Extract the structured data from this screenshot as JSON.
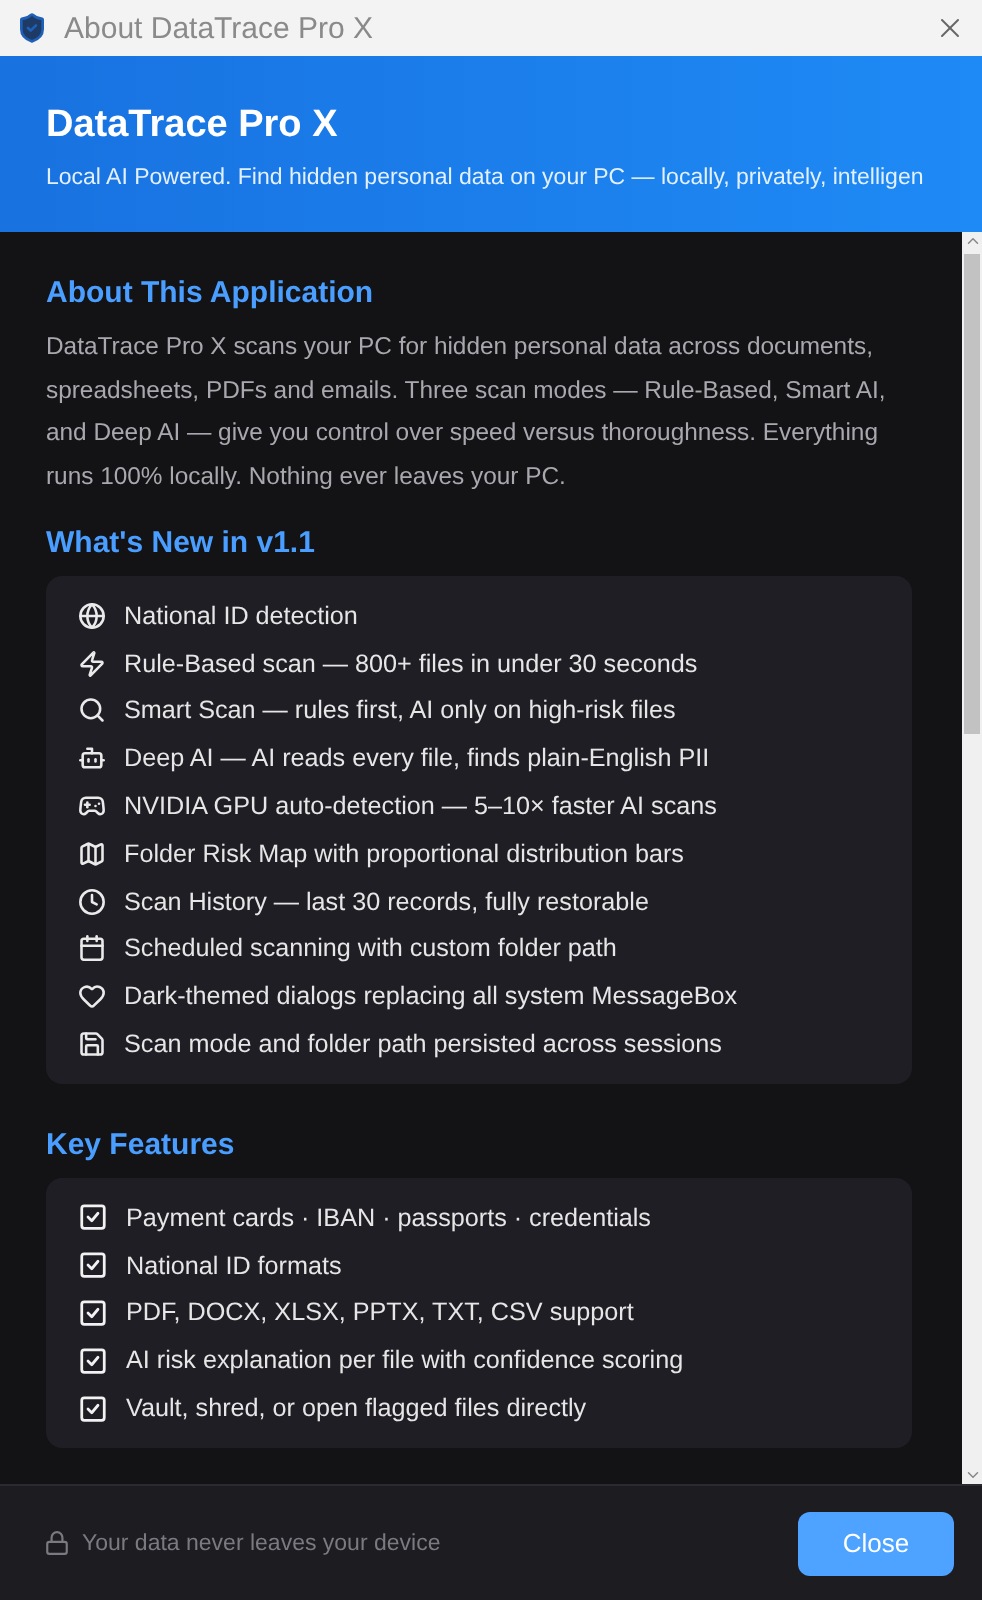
{
  "window": {
    "title": "About DataTrace Pro X"
  },
  "header": {
    "title": "DataTrace Pro X",
    "subtitle": "Local AI Powered. Find hidden personal data on your PC — locally, privately, intelligen"
  },
  "about": {
    "heading": "About This Application",
    "text": "DataTrace Pro X scans your PC for hidden personal data across documents, spreadsheets, PDFs and emails. Three scan modes — Rule-Based, Smart AI, and Deep AI — give you control over speed versus thoroughness. Everything runs 100% locally. Nothing ever leaves your PC."
  },
  "whats_new": {
    "heading": "What's New in v1.1",
    "items": [
      {
        "text": "National ID detection"
      },
      {
        "text": "Rule-Based scan — 800+ files in under 30 seconds"
      },
      {
        "text": "Smart Scan — rules first, AI only on high-risk files"
      },
      {
        "text": "Deep AI — AI reads every file, finds plain-English PII"
      },
      {
        "text": "NVIDIA GPU auto-detection — 5–10× faster AI scans"
      },
      {
        "text": "Folder Risk Map with proportional distribution bars"
      },
      {
        "text": "Scan History — last 30 records, fully restorable"
      },
      {
        "text": "Scheduled scanning with custom folder path"
      },
      {
        "text": "Dark-themed dialogs replacing all system MessageBox"
      },
      {
        "text": "Scan mode and folder path persisted across sessions"
      }
    ]
  },
  "key_features": {
    "heading": "Key Features",
    "items": [
      {
        "text": "Payment cards · IBAN · passports · credentials",
        "checked": true
      },
      {
        "text": "National ID formats",
        "checked": true
      },
      {
        "text": "PDF, DOCX, XLSX, PPTX, TXT, CSV support",
        "checked": true
      },
      {
        "text": "AI risk explanation per file with confidence scoring",
        "checked": true
      },
      {
        "text": "Vault, shred, or open flagged files directly",
        "checked": true
      }
    ]
  },
  "footer": {
    "note": "Your data never leaves your device",
    "button": "Close"
  }
}
